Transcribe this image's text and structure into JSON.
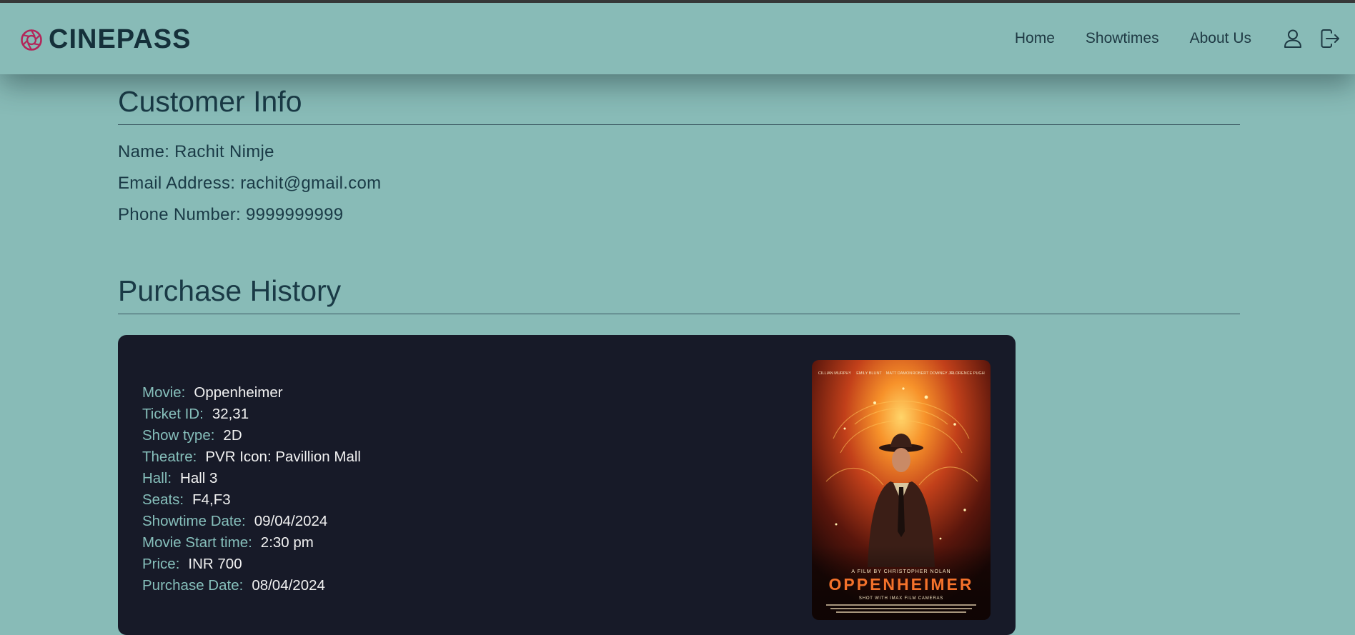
{
  "brand": {
    "name": "CINEPASS",
    "logo_icon": "aperture-icon",
    "logo_color": "#b3265a"
  },
  "nav": {
    "links": [
      "Home",
      "Showtimes",
      "About Us"
    ],
    "user_icon": "user-icon",
    "logout_icon": "logout-icon"
  },
  "customer": {
    "title": "Customer Info",
    "name": "Name: Rachit Nimje",
    "email": "Email Address: rachit@gmail.com",
    "phone": "Phone Number: 9999999999"
  },
  "history": {
    "title": "Purchase History",
    "ticket": {
      "fields": [
        {
          "label": "Movie:",
          "value": "Oppenheimer"
        },
        {
          "label": "Ticket ID:",
          "value": "32,31"
        },
        {
          "label": "Show type:",
          "value": "2D"
        },
        {
          "label": "Theatre:",
          "value": "PVR Icon: Pavillion Mall"
        },
        {
          "label": "Hall:",
          "value": "Hall 3"
        },
        {
          "label": "Seats:",
          "value": "F4,F3"
        },
        {
          "label": "Showtime Date:",
          "value": "09/04/2024"
        },
        {
          "label": "Movie Start time:",
          "value": "2:30 pm"
        },
        {
          "label": "Price:",
          "value": "INR 700"
        },
        {
          "label": "Purchase Date:",
          "value": "08/04/2024"
        }
      ],
      "poster": {
        "top_credits": [
          "CILLIAN MURPHY",
          "EMILY BLUNT",
          "MATT DAMON",
          "ROBERT DOWNEY JR.",
          "FLORENCE PUGH"
        ],
        "tagline": "A FILM BY CHRISTOPHER NOLAN",
        "title": "OPPENHEIMER",
        "subtitle": "SHOT WITH IMAX FILM CAMERAS"
      }
    }
  },
  "colors": {
    "page_bg": "#88bbb7",
    "card_bg": "#171a28",
    "label": "#86bfbb",
    "value": "#f1f1f1",
    "text": "#1a3a46"
  }
}
